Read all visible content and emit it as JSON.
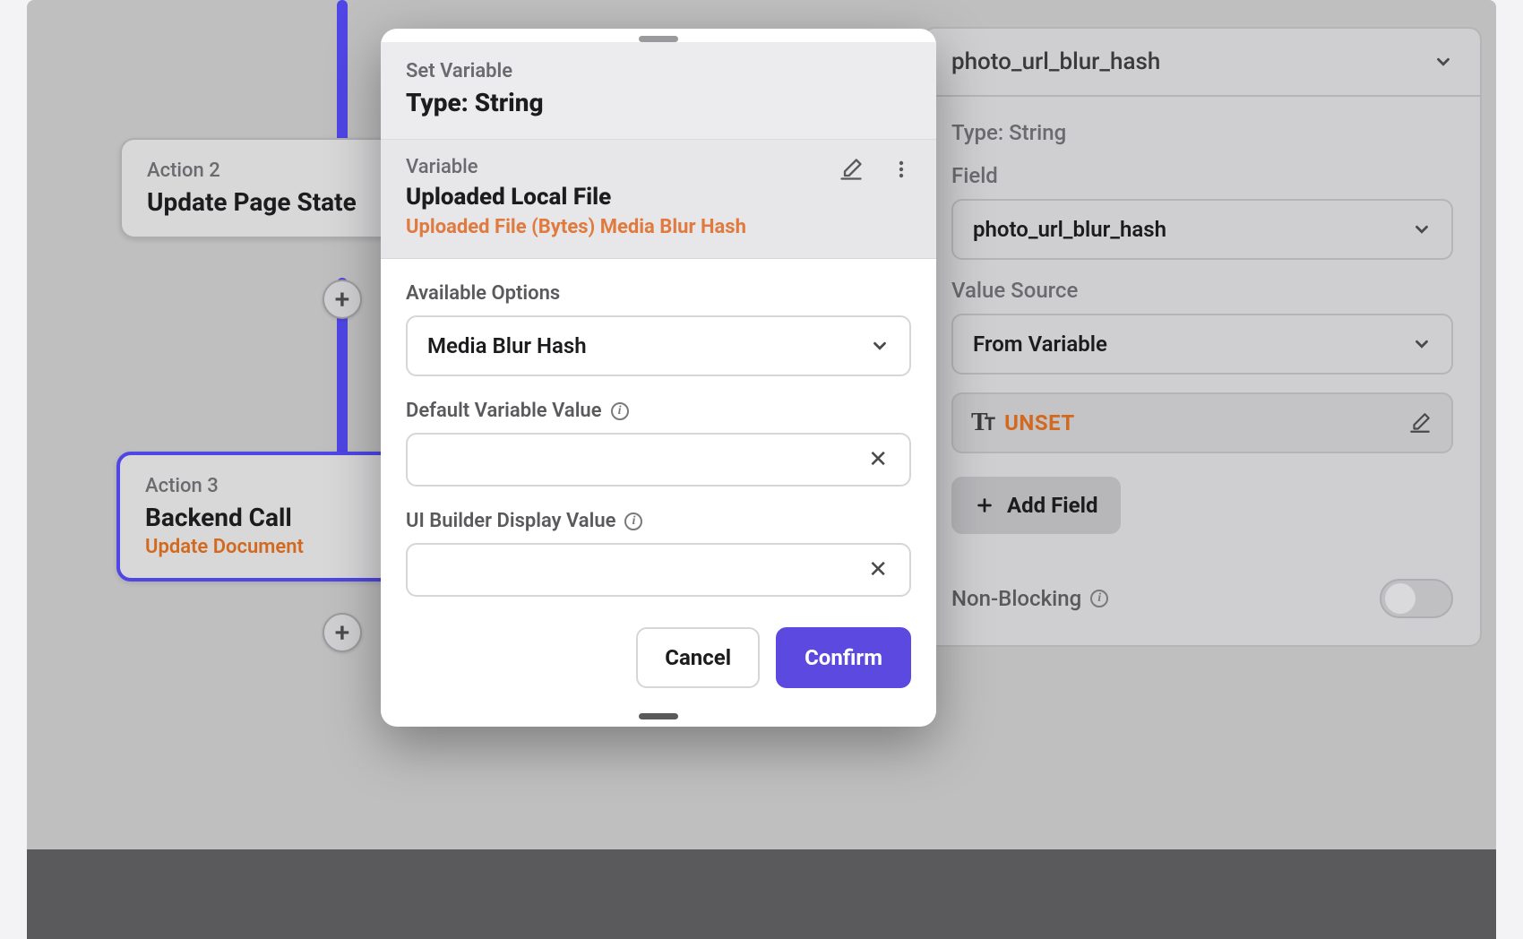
{
  "canvas": {
    "node2": {
      "label": "Action 2",
      "title": "Update Page State"
    },
    "node3": {
      "label": "Action 3",
      "title": "Backend Call",
      "subtitle": "Update Document"
    }
  },
  "modal": {
    "header_small": "Set Variable",
    "header_big": "Type: String",
    "variable_label": "Variable",
    "variable_title": "Uploaded Local File",
    "variable_sub": "Uploaded File (Bytes) Media Blur Hash",
    "available_options_label": "Available Options",
    "available_options_value": "Media Blur Hash",
    "default_value_label": "Default Variable Value",
    "default_value": "",
    "display_value_label": "UI Builder Display Value",
    "display_value": "",
    "cancel": "Cancel",
    "confirm": "Confirm"
  },
  "side": {
    "header": "photo_url_blur_hash",
    "type_line": "Type: String",
    "field_label": "Field",
    "field_value": "photo_url_blur_hash",
    "value_source_label": "Value Source",
    "value_source_value": "From Variable",
    "unset": "UNSET",
    "add_field": "Add Field",
    "non_blocking": "Non-Blocking"
  }
}
